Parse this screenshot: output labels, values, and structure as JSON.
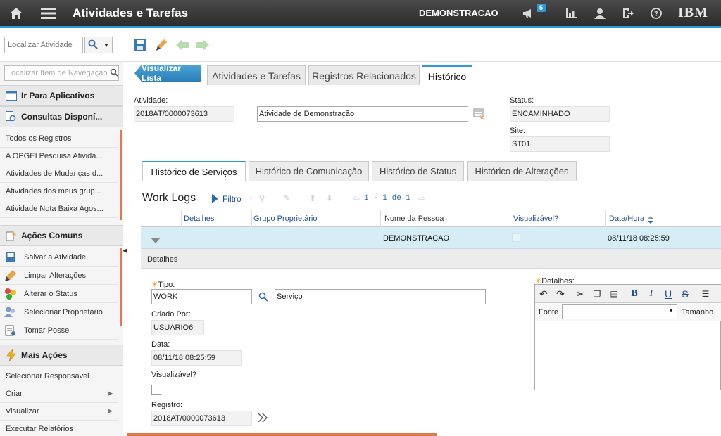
{
  "header": {
    "title": "Atividades e Tarefas",
    "user": "DEMONSTRACAO",
    "notification_count": "5",
    "brand": "IBM"
  },
  "toolbar": {
    "find_placeholder": "Localizar Atividade"
  },
  "nav": {
    "search_placeholder": "Localizar Item de Navegação",
    "goto_apps": "Ir Para Aplicativos",
    "queries": "Consultas Disponí...",
    "query_items": [
      "Todos os Registros",
      "A OPGEI Pesquisa Ativida...",
      "Atividades de Mudanças d...",
      "Atividades dos meus grup...",
      "Atividade Nota Baixa Agos..."
    ],
    "common_actions": "Ações Comuns",
    "actions": [
      "Salvar a Atividade",
      "Limpar Alterações",
      "Alterar o Status",
      "Selecionar Proprietário",
      "Tomar Posse"
    ],
    "more_actions": "Mais Ações",
    "more_items": [
      "Selecionar Responsável",
      "Criar",
      "Visualizar",
      "Executar Relatórios"
    ]
  },
  "tabs": {
    "back": "Visualizar Lista",
    "items": [
      "Atividades e Tarefas",
      "Registros Relacionados",
      "Histórico"
    ],
    "active": "Histórico"
  },
  "record": {
    "activity_label": "Atividade:",
    "activity_id": "2018AT/0000073613",
    "description": "Atividade de Demonstração",
    "status_label": "Status:",
    "status": "ENCAMINHADO",
    "site_label": "Site:",
    "site": "ST01"
  },
  "subtabs": {
    "items": [
      "Histórico de Serviços",
      "Histórico de Comunicação",
      "Histórico de Status",
      "Histórico de Alterações"
    ],
    "active": "Histórico de Serviços"
  },
  "worklogs": {
    "title": "Work Logs",
    "filter": "Filtro",
    "page_info": "1 - 1 de 1",
    "columns": [
      "Detalhes",
      "Grupo Proprietário",
      "Nome da Pessoa",
      "Visualizável?",
      "Data/Hora"
    ],
    "row": {
      "person": "DEMONSTRACAO",
      "datetime": "08/11/18 08:25:59"
    }
  },
  "details": {
    "section": "Detalhes",
    "type_label": "Tipo:",
    "type": "WORK",
    "type_desc": "Serviço",
    "created_by_label": "Criado Por:",
    "created_by": "USUARIO6",
    "date_label": "Data:",
    "date": "08/11/18 08:25:59",
    "viewable_label": "Visualizável?",
    "record_label": "Registro:",
    "record": "2018AT/0000073613",
    "details_label": "Detalhes:",
    "font_label": "Fonte",
    "size_label": "Tamanho"
  }
}
